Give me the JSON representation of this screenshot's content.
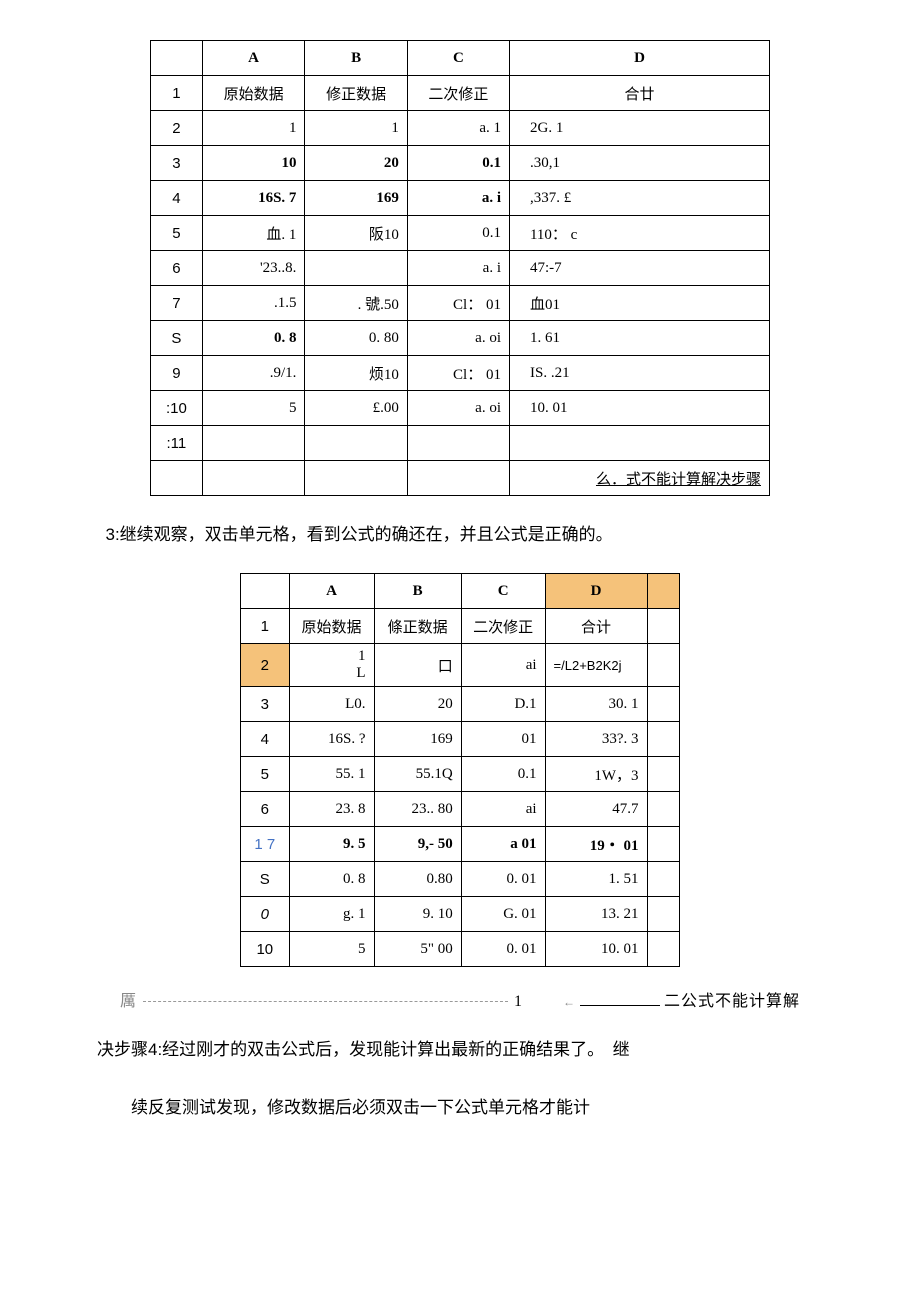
{
  "table1": {
    "colheads": [
      "",
      "A",
      "B",
      "C",
      "D"
    ],
    "rows": [
      {
        "n": "1",
        "a": "原始数据",
        "b": "修正数据",
        "c": "二次修正",
        "d": "合廿",
        "header": true
      },
      {
        "n": "2",
        "a": "1",
        "b": "1",
        "c": "a. 1",
        "d": "2G. 1"
      },
      {
        "n": "3",
        "a": "10",
        "b": "20",
        "c": "0.1",
        "d": ".30,1",
        "bold": true
      },
      {
        "n": "4",
        "a": "16S. 7",
        "b": "169",
        "c": "a. i",
        "d": ",337. £",
        "bold": true
      },
      {
        "n": "5",
        "a": "血. 1",
        "b": "阪10",
        "c": "0.1",
        "d": "110： c"
      },
      {
        "n": "6",
        "a": "'23..8.",
        "b": "",
        "c": "a. i",
        "d": "47:-7"
      },
      {
        "n": "7",
        "a": ".1.5",
        "b": ". 號.50",
        "c": "Cl： 01",
        "d": "血01"
      },
      {
        "n": "S",
        "a": "0. 8",
        "b": "0. 80",
        "c": "a. oi",
        "d": "1. 61",
        "bold_a": true
      },
      {
        "n": "9",
        "a": ".9/1.",
        "b": "烦10",
        "c": "Cl： 01",
        "d": "IS. .21"
      },
      {
        "n": ":10",
        "a": "5",
        "b": "£.00",
        "c": "a. oi",
        "d": "10. 01"
      },
      {
        "n": ":11",
        "a": "",
        "b": "",
        "c": "",
        "d": ""
      }
    ],
    "footer": "么．式不能计算解决步骤"
  },
  "para1": "3:继续观察，双击单元格，看到公式的确还在，并且公式是正确的。",
  "table2": {
    "colheads": [
      "",
      "A",
      "B",
      "C",
      "D"
    ],
    "rows": [
      {
        "n": "1",
        "a": "原始数据",
        "b": "條正数据",
        "c": "二次修正",
        "d": "合计",
        "header": true
      },
      {
        "n": "2",
        "a": "1\nL",
        "b": "口",
        "c": "ai",
        "d": "=/L2+B2K2j",
        "formula": true
      },
      {
        "n": "3",
        "a": "L0.",
        "b": "20",
        "c": "D.1",
        "d": "30. 1"
      },
      {
        "n": "4",
        "a": "16S. ?",
        "b": "169",
        "c": "01",
        "d": "33?. 3"
      },
      {
        "n": "5",
        "a": "55. 1",
        "b": "55.1Q",
        "c": "0.1",
        "d": "1W，3"
      },
      {
        "n": "6",
        "a": "23. 8",
        "b": "23.. 80",
        "c": "ai",
        "d": "47.7"
      },
      {
        "n": "1 7",
        "a": "9. 5",
        "b": "9,- 50",
        "c": "a 01",
        "d": "19・ 01",
        "blue": true,
        "bold": true
      },
      {
        "n": "S",
        "a": "0. 8",
        "b": "0.80",
        "c": "0. 01",
        "d": "1. 51"
      },
      {
        "n": "0",
        "a": "g. 1",
        "b": "9. 10",
        "c": "G. 01",
        "d": "13. 21",
        "ital": true
      },
      {
        "n": "10",
        "a": "5",
        "b": "5\" 00",
        "c": "0. 01",
        "d": "10. 01"
      }
    ]
  },
  "line2": {
    "left": "厲",
    "mid": "1",
    "right": "二公式不能计算解"
  },
  "para2": "决步骤4:经过刚才的双击公式后，发现能计算出最新的正确结果了。　继",
  "para3": "续反复测试发现，修改数据后必须双击一下公式单元格才能计"
}
